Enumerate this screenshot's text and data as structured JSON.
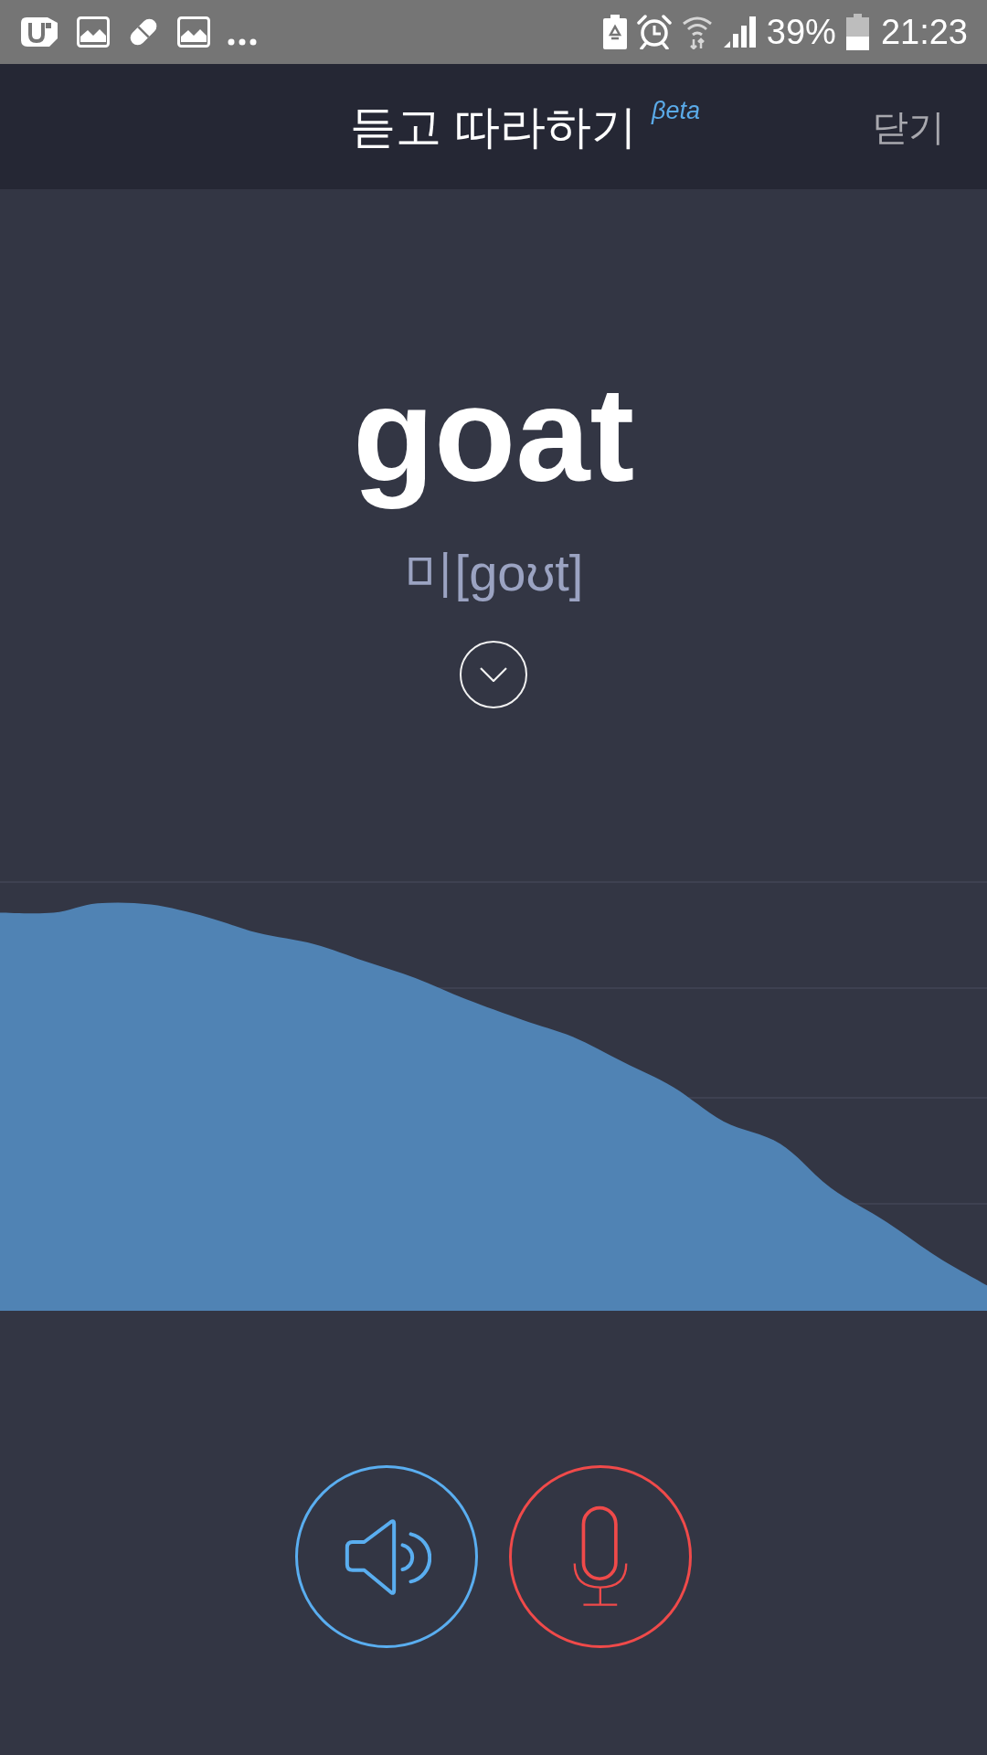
{
  "status_bar": {
    "battery": "39%",
    "time": "21:23"
  },
  "header": {
    "title": "듣고 따라하기",
    "badge": "βeta",
    "close": "닫기"
  },
  "word": {
    "text": "goat",
    "pronunciation": "미[goʊt]"
  },
  "controls": [
    {
      "kind": "listen"
    },
    {
      "kind": "record"
    }
  ]
}
